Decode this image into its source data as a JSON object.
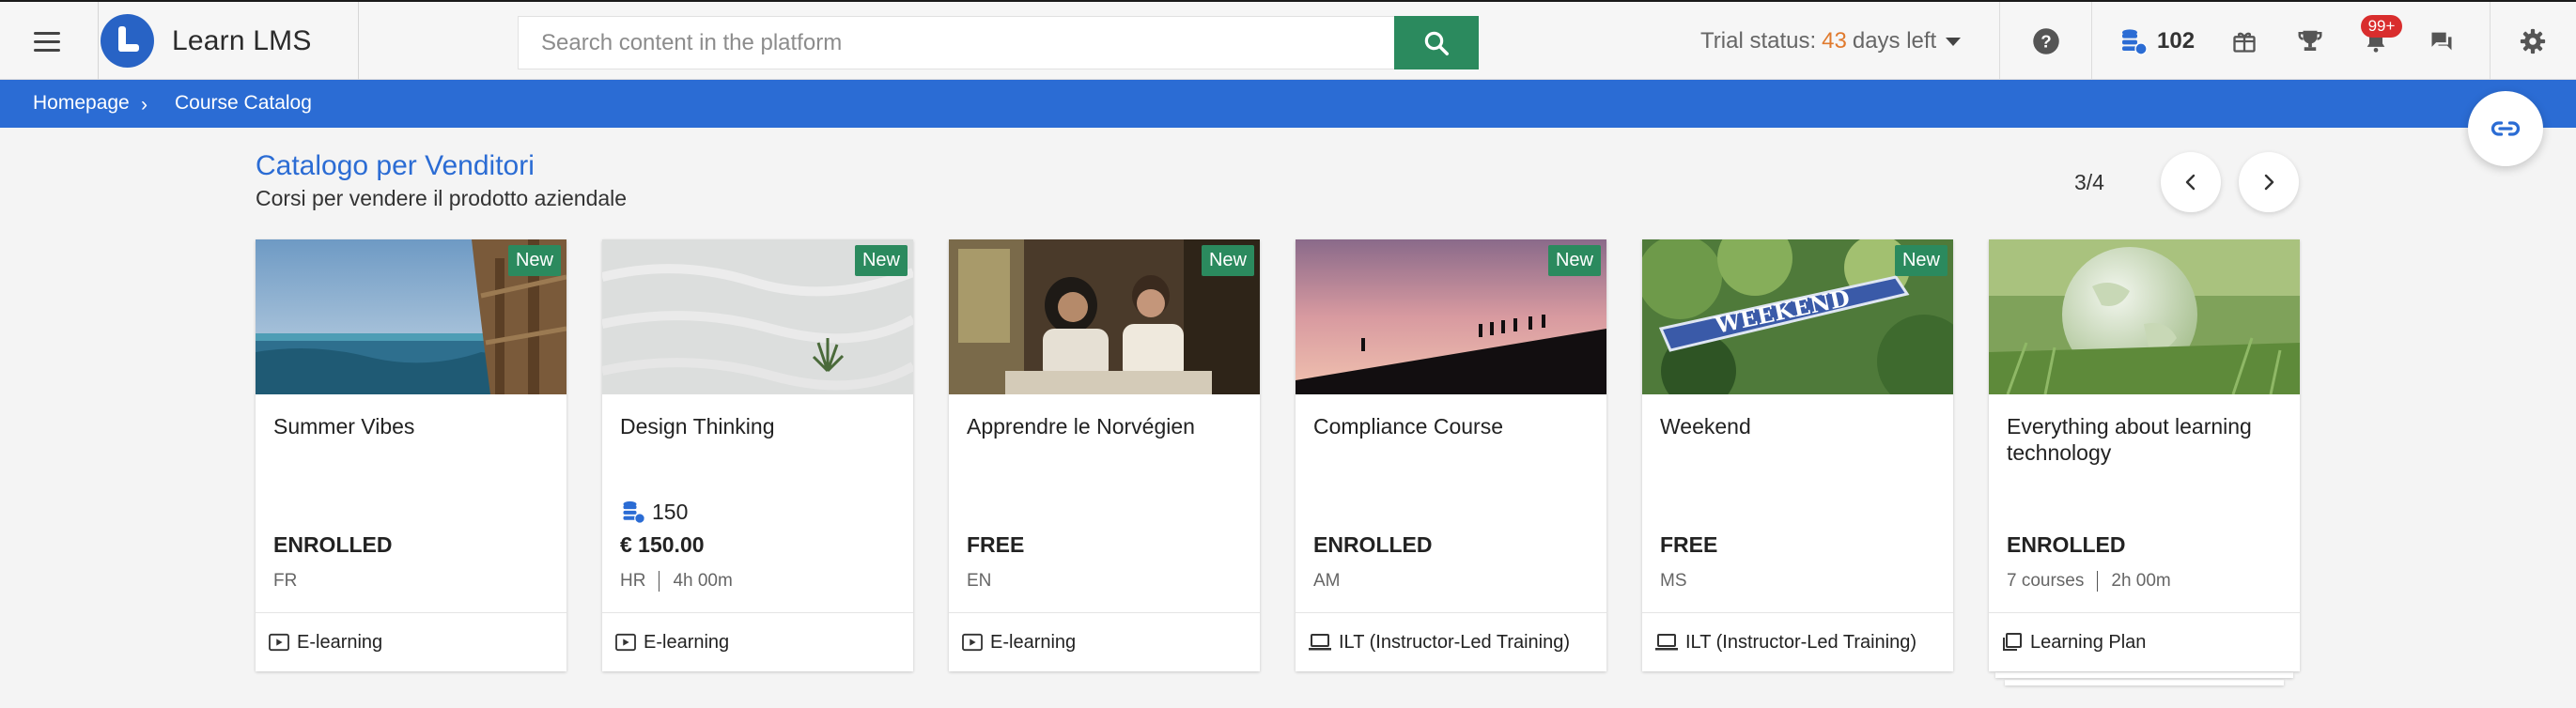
{
  "app": {
    "name": "Learn LMS"
  },
  "search": {
    "placeholder": "Search content in the platform"
  },
  "trial": {
    "prefix": "Trial status:",
    "days": "43",
    "suffix": "days left"
  },
  "coins": {
    "count": "102"
  },
  "notifications": {
    "badge": "99+"
  },
  "breadcrumb": {
    "home": "Homepage",
    "current": "Course Catalog"
  },
  "catalog": {
    "title": "Catalogo per Venditori",
    "subtitle": "Corsi per vendere il prodotto aziendale",
    "pager": "3/4"
  },
  "colors": {
    "brand": "#2b6cd4",
    "accent_green": "#2b8a5e",
    "badge_red": "#d92d2d",
    "trial_days": "#e07a2e"
  },
  "cards": [
    {
      "title": "Summer Vibes",
      "badge": "New",
      "status": "ENROLLED",
      "lang": "FR",
      "type": "E-learning",
      "type_icon": "play-icon"
    },
    {
      "title": "Design Thinking",
      "badge": "New",
      "coins": "150",
      "status": "€ 150.00",
      "lang": "HR",
      "duration": "4h 00m",
      "type": "E-learning",
      "type_icon": "play-icon"
    },
    {
      "title": "Apprendre le Norvégien",
      "badge": "New",
      "status": "FREE",
      "lang": "EN",
      "type": "E-learning",
      "type_icon": "play-icon"
    },
    {
      "title": "Compliance Course",
      "badge": "New",
      "status": "ENROLLED",
      "lang": "AM",
      "type": "ILT (Instructor-Led Training)",
      "type_icon": "laptop-icon"
    },
    {
      "title": "Weekend",
      "badge": "New",
      "status": "FREE",
      "lang": "MS",
      "type": "ILT (Instructor-Led Training)",
      "type_icon": "laptop-icon"
    },
    {
      "title": "Everything about learning technology",
      "status": "ENROLLED",
      "courses": "7 courses",
      "duration": "2h 00m",
      "type": "Learning Plan",
      "type_icon": "stack-icon"
    }
  ]
}
